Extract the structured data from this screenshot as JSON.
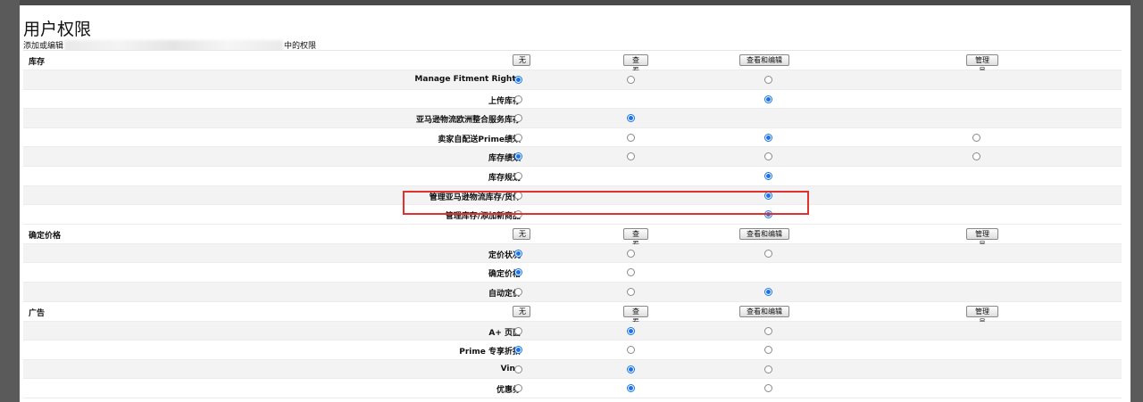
{
  "page": {
    "title": "用户权限",
    "subtitle_prefix": "添加或编辑",
    "subtitle_suffix": "中的权限"
  },
  "levels": [
    "无",
    "查看",
    "查看和编辑",
    "管理员"
  ],
  "sections": [
    {
      "name": "库存",
      "rows": [
        {
          "label": "Manage Fitment Rights",
          "options": [
            0,
            1,
            2
          ],
          "selected": 0
        },
        {
          "label": "上传库存",
          "options": [
            0,
            2
          ],
          "selected": 2
        },
        {
          "label": "亚马逊物流欧洲整合服务库存",
          "options": [
            0,
            1
          ],
          "selected": 1
        },
        {
          "label": "卖家自配送Prime绩效",
          "options": [
            0,
            1,
            2,
            3
          ],
          "selected": 2
        },
        {
          "label": "库存绩效",
          "options": [
            0,
            1,
            2,
            3
          ],
          "selected": 0
        },
        {
          "label": "库存规划",
          "options": [
            0,
            2
          ],
          "selected": 2
        },
        {
          "label": "管理亚马逊物流库存/货件",
          "options": [
            0,
            2
          ],
          "selected": 2
        },
        {
          "label": "管理库存/添加新商品",
          "options": [
            0,
            2
          ],
          "selected": 2
        }
      ]
    },
    {
      "name": "确定价格",
      "rows": [
        {
          "label": "定价状况",
          "options": [
            0,
            1,
            2
          ],
          "selected": 0
        },
        {
          "label": "确定价格",
          "options": [
            0,
            1
          ],
          "selected": 0
        },
        {
          "label": "自动定价",
          "options": [
            0,
            1,
            2
          ],
          "selected": 2
        }
      ]
    },
    {
      "name": "广告",
      "rows": [
        {
          "label": "A+ 页面",
          "options": [
            0,
            1,
            2
          ],
          "selected": 1
        },
        {
          "label": "Prime 专享折扣",
          "options": [
            0,
            1,
            2
          ],
          "selected": 0
        },
        {
          "label": "Vine",
          "options": [
            0,
            1,
            2
          ],
          "selected": 1
        },
        {
          "label": "优惠券",
          "options": [
            0,
            1,
            2
          ],
          "selected": 1
        }
      ]
    }
  ],
  "colors": {
    "radio_selected": "#1a73e8",
    "highlight_box": "#e0302f"
  }
}
